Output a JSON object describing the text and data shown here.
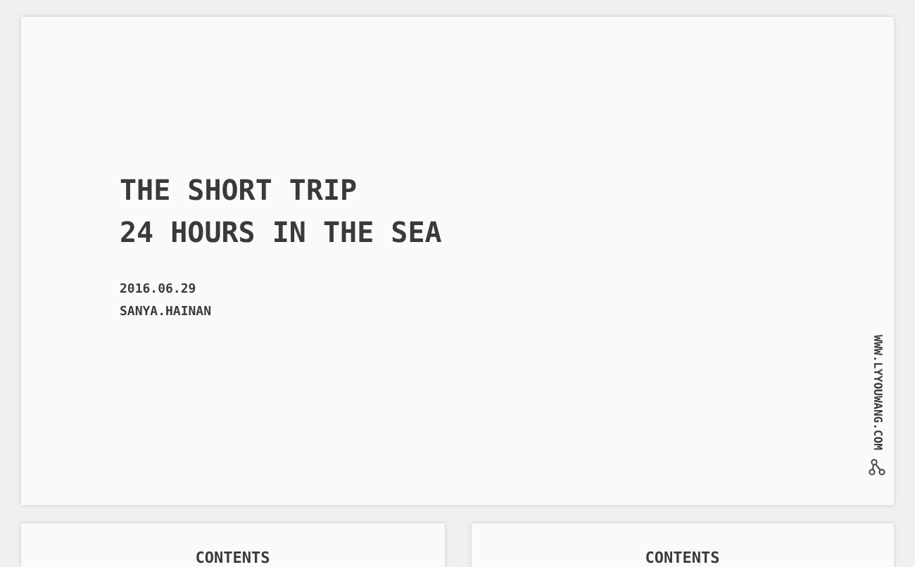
{
  "hero": {
    "title_lines": [
      "THE SHORT TRIP",
      "24 HOURS IN THE SEA"
    ],
    "date": "2016.06.29",
    "place": "SANYA.HAINAN",
    "website": "WWW.LYYOUWANG.COM"
  },
  "cards": [
    {
      "heading": "CONTENTS"
    },
    {
      "heading": "CONTENTS"
    }
  ]
}
